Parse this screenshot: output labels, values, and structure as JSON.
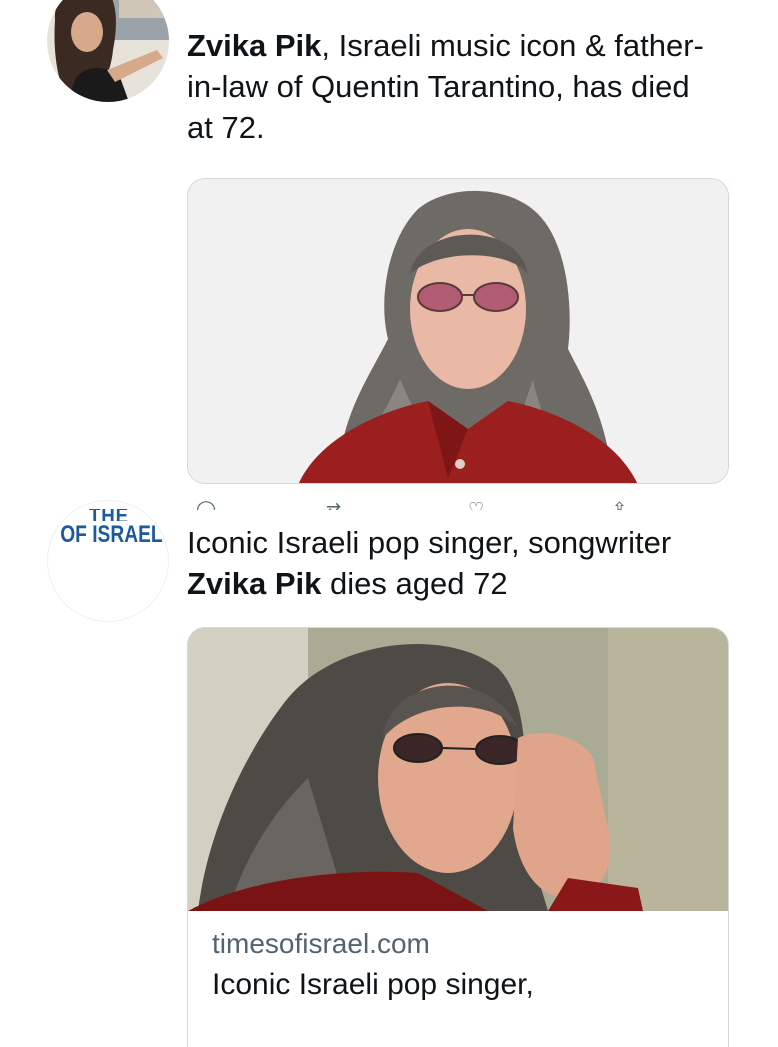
{
  "tweet1": {
    "author_bold": "Zvika Pik",
    "text": ", Israeli music icon & father-in-law of Quentin Tarantino, has died at 72.",
    "avatar": "avatar-woman-photo",
    "media": "photo-man-long-gray-hair-red-glasses-red-shirt"
  },
  "tweet2": {
    "avatar_logo_top": "THE TIMES",
    "avatar_logo_bottom": "OF ISRAEL",
    "text_before": "Iconic Israeli pop singer, songwriter ",
    "text_bold": "Zvika Pik",
    "text_after": " dies aged 72",
    "card": {
      "domain": "timesofisrael.com",
      "title": "Iconic Israeli pop singer,",
      "media": "photo-man-adjusting-sunglasses"
    }
  },
  "colors": {
    "text": "#0f1419",
    "secondary": "#536471",
    "border": "#cfd9de",
    "toi_blue": "#1d5a9c"
  },
  "icons": [
    "reply-icon",
    "retweet-icon",
    "like-icon",
    "share-icon"
  ]
}
